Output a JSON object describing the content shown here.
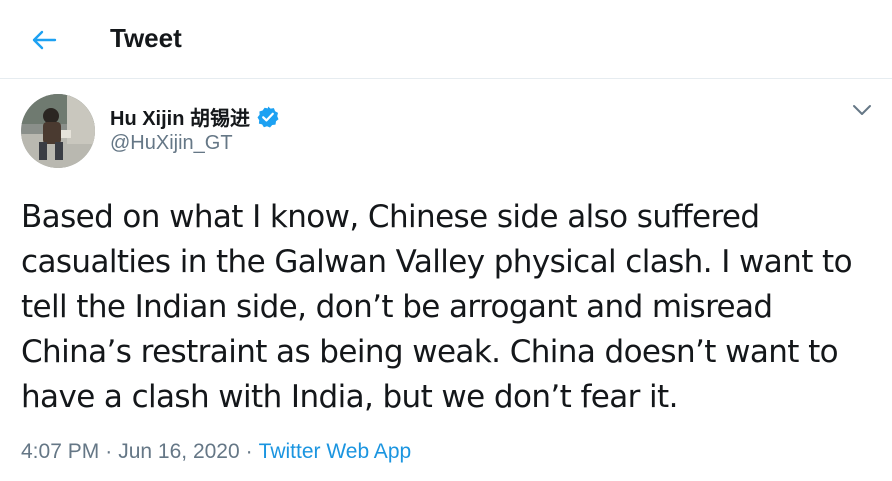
{
  "header": {
    "title": "Tweet",
    "back_icon": "arrow-left-icon"
  },
  "colors": {
    "accent": "#1b95e0",
    "secondary_text": "#657786",
    "primary_text": "#14171a",
    "divider": "#e6ecf0",
    "verified": "#1da1f2"
  },
  "tweet": {
    "author": {
      "name": "Hu Xijin 胡锡进",
      "handle": "@HuXijin_GT",
      "verified": true
    },
    "text": "Based on what I know, Chinese side also suffered casualties in the Galwan Valley physical clash. I want to tell the Indian side, don’t be arrogant and misread China’s restraint as being weak. China doesn’t want to have a clash with India, but we don’t fear it.",
    "time": "4:07 PM",
    "date": "Jun 16, 2020",
    "separator": "·",
    "source": "Twitter Web App"
  }
}
